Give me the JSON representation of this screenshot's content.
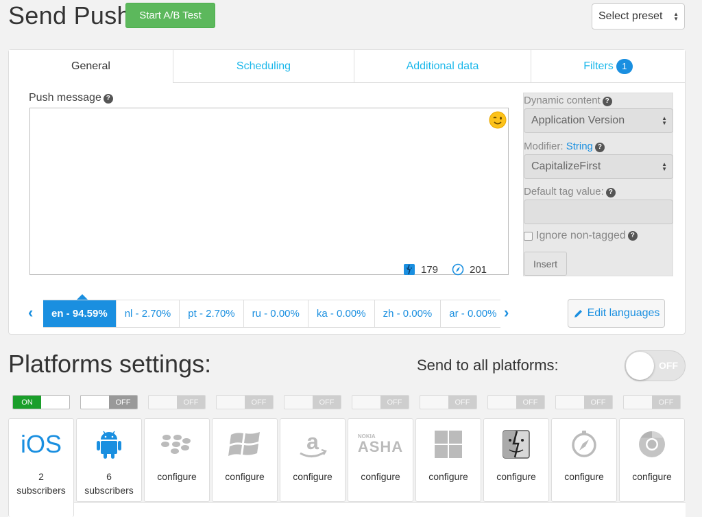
{
  "header": {
    "title": "Send Push",
    "ab_button": "Start A/B Test",
    "preset_select": "Select preset"
  },
  "tabs": [
    {
      "label": "General",
      "active": true
    },
    {
      "label": "Scheduling",
      "active": false
    },
    {
      "label": "Additional data",
      "active": false
    },
    {
      "label": "Filters",
      "active": false,
      "count": "1"
    }
  ],
  "message": {
    "label": "Push message",
    "emoji_icon": "wink-emoji-icon",
    "counters": [
      {
        "icon": "macos-finder-icon",
        "value": "179"
      },
      {
        "icon": "safari-icon",
        "value": "201"
      }
    ]
  },
  "dynamic": {
    "content_label": "Dynamic content",
    "content_value": "Application Version",
    "modifier_label": "Modifier:",
    "modifier_link": "String",
    "modifier_value": "CapitalizeFirst",
    "default_tag_label": "Default tag value:",
    "default_tag_value": "",
    "ignore_label": "Ignore non-tagged",
    "insert_button": "Insert"
  },
  "languages": {
    "tabs": [
      {
        "label": "en - 94.59%",
        "active": true
      },
      {
        "label": "nl - 2.70%",
        "active": false
      },
      {
        "label": "pt - 2.70%",
        "active": false
      },
      {
        "label": "ru - 0.00%",
        "active": false
      },
      {
        "label": "ka - 0.00%",
        "active": false
      },
      {
        "label": "zh - 0.00%",
        "active": false
      },
      {
        "label": "ar - 0.00%",
        "active": false
      }
    ],
    "edit_button": "Edit languages"
  },
  "platforms": {
    "title": "Platforms settings:",
    "send_all_label": "Send to all platforms:",
    "send_all_toggle": "OFF",
    "toggle_on": "ON",
    "toggle_off": "OFF",
    "tiles": [
      {
        "icon": "ios-icon",
        "name": "iOS",
        "line1": "2",
        "line2": "subscribers",
        "enabled": true,
        "active": true
      },
      {
        "icon": "android-icon",
        "line1": "6",
        "line2": "subscribers",
        "enabled": false,
        "active": false
      },
      {
        "icon": "blackberry-icon",
        "line1": "",
        "line2": "configure",
        "enabled": false,
        "active": false
      },
      {
        "icon": "windows-phone-icon",
        "line1": "",
        "line2": "configure",
        "enabled": false,
        "active": false
      },
      {
        "icon": "amazon-icon",
        "line1": "",
        "line2": "configure",
        "enabled": false,
        "active": false
      },
      {
        "icon": "nokia-asha-icon",
        "name": "ASHA",
        "brand": "NOKIA",
        "line1": "",
        "line2": "configure",
        "enabled": false,
        "active": false
      },
      {
        "icon": "windows-icon",
        "line1": "",
        "line2": "configure",
        "enabled": false,
        "active": false
      },
      {
        "icon": "macos-finder-icon",
        "line1": "",
        "line2": "configure",
        "enabled": false,
        "active": false
      },
      {
        "icon": "safari-icon",
        "line1": "",
        "line2": "configure",
        "enabled": false,
        "active": false
      },
      {
        "icon": "chrome-icon",
        "line1": "",
        "line2": "configure",
        "enabled": false,
        "active": false
      }
    ]
  },
  "colors": {
    "accent": "#1a8fe0",
    "success": "#5cb85c",
    "toggle_on": "#1a9e2a"
  }
}
